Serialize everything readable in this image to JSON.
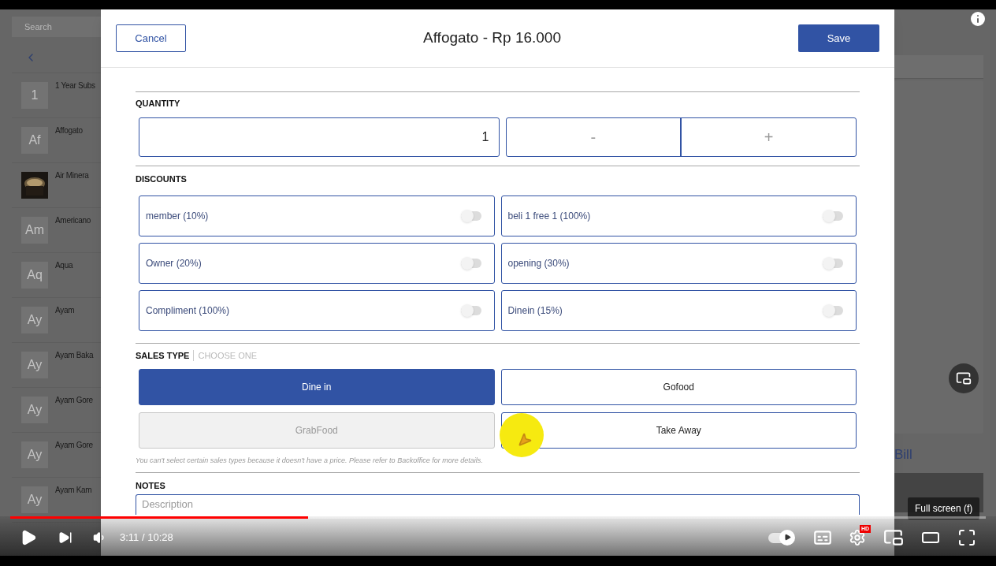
{
  "background_app": {
    "search": {
      "placeholder": "Search"
    },
    "items": [
      {
        "kind": "initials",
        "initials": "1",
        "name": "1 Year Subs"
      },
      {
        "kind": "initials",
        "initials": "Af",
        "name": "Affogato"
      },
      {
        "kind": "picture",
        "name": "Air Minera"
      },
      {
        "kind": "initials",
        "initials": "Am",
        "name": "Americano"
      },
      {
        "kind": "initials",
        "initials": "Aq",
        "name": "Aqua"
      },
      {
        "kind": "initials",
        "initials": "Ay",
        "name": "Ayam"
      },
      {
        "kind": "initials",
        "initials": "Ay",
        "name": "Ayam Baka"
      },
      {
        "kind": "initials",
        "initials": "Ay",
        "name": "Ayam Gore"
      },
      {
        "kind": "initials",
        "initials": "Ay",
        "name": "Ayam Gore"
      },
      {
        "kind": "initials",
        "initials": "Ay",
        "name": "Ayam Kam"
      }
    ],
    "bill_label": "Bill"
  },
  "dialog": {
    "cancel": "Cancel",
    "title": "Affogato - Rp 16.000",
    "save": "Save",
    "quantity": {
      "label": "QUANTITY",
      "value": "1",
      "minus": "-",
      "plus": "+"
    },
    "discounts": {
      "label": "DISCOUNTS",
      "items": [
        {
          "name": "member (10%)",
          "on": false
        },
        {
          "name": "beli 1 free 1 (100%)",
          "on": false
        },
        {
          "name": "Owner (20%)",
          "on": false
        },
        {
          "name": "opening (30%)",
          "on": false
        },
        {
          "name": "Compliment (100%)",
          "on": false
        },
        {
          "name": "Dinein (15%)",
          "on": false
        }
      ]
    },
    "sales_type": {
      "label": "SALES TYPE",
      "hint": "CHOOSE ONE",
      "options": [
        {
          "label": "Dine in",
          "selected": true,
          "disabled": false
        },
        {
          "label": "Gofood",
          "selected": false,
          "disabled": false
        },
        {
          "label": "GrabFood",
          "selected": false,
          "disabled": true
        },
        {
          "label": "Take Away",
          "selected": false,
          "disabled": false
        }
      ],
      "note": "You can't select certain sales types because it doesn't have a price. Please refer to Backoffice for more details."
    },
    "notes": {
      "label": "NOTES",
      "placeholder": "Description"
    }
  },
  "player": {
    "time": "3:11 / 10:28",
    "progress": {
      "level": 0.305
    },
    "autoplay_on": true,
    "quality_badge": "HD",
    "tooltip": "Full screen (f)"
  }
}
